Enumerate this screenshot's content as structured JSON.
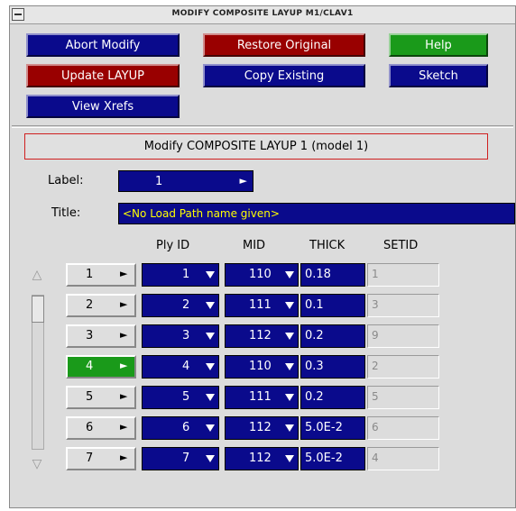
{
  "window": {
    "title": "MODIFY COMPOSITE LAYUP M1/CLAV1"
  },
  "buttons": {
    "abort": "Abort Modify",
    "restore": "Restore Original",
    "help": "Help",
    "update": "Update LAYUP",
    "copy": "Copy Existing",
    "sketch": "Sketch",
    "xrefs": "View Xrefs"
  },
  "heading": "Modify COMPOSITE LAYUP 1 (model 1)",
  "label": {
    "caption": "Label:",
    "value": "1"
  },
  "title": {
    "caption": "Title:",
    "value": "<No Load Path name given>"
  },
  "columns": {
    "ply_id": "Ply ID",
    "mid": "MID",
    "thick": "THICK",
    "setid": "SETID"
  },
  "rows": [
    {
      "num": "1",
      "ply": "1",
      "mid": "110",
      "thick": "0.18",
      "setid": "1",
      "active": false
    },
    {
      "num": "2",
      "ply": "2",
      "mid": "111",
      "thick": "0.1",
      "setid": "3",
      "active": false
    },
    {
      "num": "3",
      "ply": "3",
      "mid": "112",
      "thick": "0.2",
      "setid": "9",
      "active": false
    },
    {
      "num": "4",
      "ply": "4",
      "mid": "110",
      "thick": "0.3",
      "setid": "2",
      "active": true
    },
    {
      "num": "5",
      "ply": "5",
      "mid": "111",
      "thick": "0.2",
      "setid": "5",
      "active": false
    },
    {
      "num": "6",
      "ply": "6",
      "mid": "112",
      "thick": "5.0E-2",
      "setid": "6",
      "active": false
    },
    {
      "num": "7",
      "ply": "7",
      "mid": "112",
      "thick": "5.0E-2",
      "setid": "4",
      "active": false
    }
  ],
  "colors": {
    "blue": "#0a0a8c",
    "red": "#990000",
    "green": "#1a9a1a",
    "highlight_border": "#d02020"
  },
  "icons": {
    "row_arrow": "triangle-right-icon",
    "dropdown": "triangle-down-icon",
    "scroll_up": "scroll-up-icon",
    "scroll_down": "scroll-down-icon"
  }
}
